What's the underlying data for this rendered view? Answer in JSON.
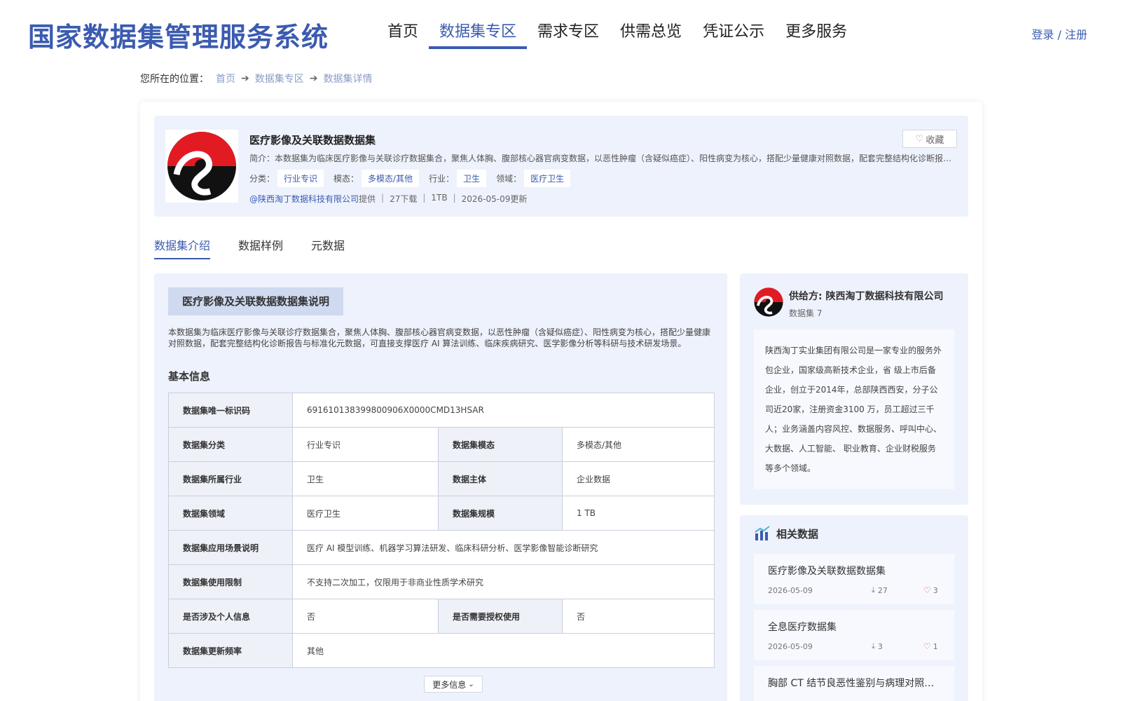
{
  "header": {
    "site_title": "国家数据集管理服务系统",
    "nav": [
      "首页",
      "数据集专区",
      "需求专区",
      "供需总览",
      "凭证公示",
      "更多服务"
    ],
    "active_nav": 1,
    "login": "登录 / 注册"
  },
  "breadcrumb": {
    "prefix": "您所在的位置：",
    "items": [
      "首页",
      "数据集专区",
      "数据集详情"
    ]
  },
  "dataset": {
    "title": "医疗影像及关联数据数据集",
    "desc": "简介：本数据集为临床医疗影像与关联诊疗数据集合，聚焦人体胸、腹部核心器官病变数据，以恶性肿瘤（含疑似癌症）、阳性病变为核心，搭配少量健康对照数据，配套完整结构化诊断报告与标准化元数据，可直接支撑医疗 AI 算法训练、临床疾病研究、医学影像分析等科研与技术研发场景。",
    "tags": [
      {
        "label": "分类：",
        "value": "行业专识"
      },
      {
        "label": "模态：",
        "value": "多模态/其他"
      },
      {
        "label": "行业：",
        "value": "卫生"
      },
      {
        "label": "领域：",
        "value": "医疗卫生"
      }
    ],
    "provider": "@陕西淘丁数据科技有限公司",
    "provider_suffix": "提供",
    "downloads": "27下载",
    "size": "1TB",
    "updated": "2026-05-09更新",
    "fav_label": "收藏"
  },
  "tabs": [
    "数据集介绍",
    "数据样例",
    "元数据"
  ],
  "intro": {
    "section_title": "医疗影像及关联数据数据集说明",
    "text": "本数据集为临床医疗影像与关联诊疗数据集合，聚焦人体胸、腹部核心器官病变数据，以恶性肿瘤（含疑似癌症）、阳性病变为核心，搭配少量健康对照数据，配套完整结构化诊断报告与标准化元数据，可直接支撑医疗 AI 算法训练、临床疾病研究、医学影像分析等科研与技术研发场景。",
    "basic_title": "基本信息",
    "more_label": "更多信息"
  },
  "info": {
    "uid_k": "数据集唯一标识码",
    "uid_v": "691610138399800906X0000CMD13HSAR",
    "cat_k": "数据集分类",
    "cat_v": "行业专识",
    "mod_k": "数据集模态",
    "mod_v": "多模态/其他",
    "ind_k": "数据集所属行业",
    "ind_v": "卫生",
    "sub_k": "数据主体",
    "sub_v": "企业数据",
    "dom_k": "数据集领域",
    "dom_v": "医疗卫生",
    "scale_k": "数据集规模",
    "scale_v": "1 TB",
    "app_k": "数据集应用场景说明",
    "app_v": "医疗 AI 模型训练、机器学习算法研发、临床科研分析、医学影像智能诊断研究",
    "lim_k": "数据集使用限制",
    "lim_v": "不支持二次加工，仅限用于非商业性质学术研究",
    "pi_k": "是否涉及个人信息",
    "pi_v": "否",
    "auth_k": "是否需要授权使用",
    "auth_v": "否",
    "freq_k": "数据集更新频率",
    "freq_v": "其他"
  },
  "supplier": {
    "name": "供给方: 陕西淘丁数据科技有限公司",
    "count": "数据集 7",
    "desc": "陕西淘丁实业集团有限公司是一家专业的服务外包企业，国家级高新技术企业，省 级上市后备企业，创立于2014年，总部陕西西安，分子公司近20家，注册资金3100 万，员工超过三千人；业务涵盖内容风控、数据服务、呼叫中心、大数据、人工智能、 职业教育、企业财税服务等多个领域。"
  },
  "related": {
    "title": "相关数据",
    "items": [
      {
        "name": "医疗影像及关联数据数据集",
        "date": "2026-05-09",
        "downloads": "27",
        "likes": "3"
      },
      {
        "name": "全息医疗数据集",
        "date": "2026-05-09",
        "downloads": "3",
        "likes": "1"
      },
      {
        "name": "胸部 CT 结节良恶性鉴别与病理对照数据集",
        "date": "",
        "downloads": "",
        "likes": ""
      }
    ]
  },
  "colors": {
    "primary": "#3b5bb0",
    "panel_bg": "#eef2fc",
    "logo_red": "#e21b23"
  }
}
